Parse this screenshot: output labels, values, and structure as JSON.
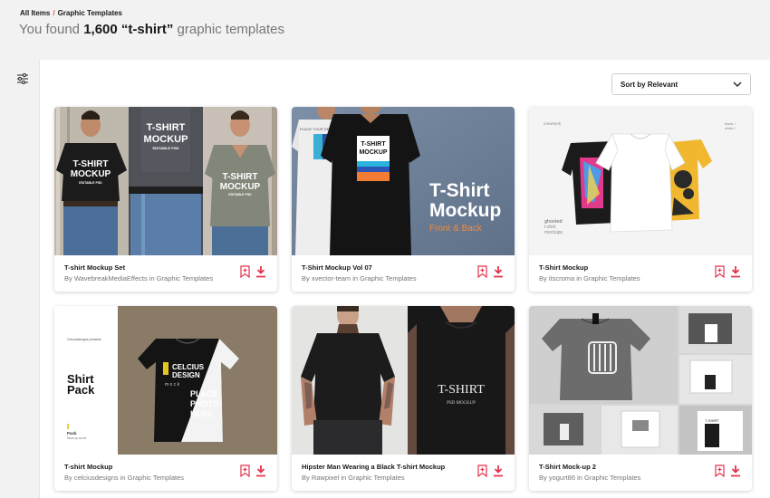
{
  "breadcrumb": {
    "all_items": "All Items",
    "separator": "/",
    "current": "Graphic Templates"
  },
  "headline": {
    "prefix": "You found ",
    "count_query": "1,600 “t-shirt”",
    "suffix": " graphic templates"
  },
  "sort": {
    "selected": "Sort by Relevant"
  },
  "icons": {
    "filter": "filter-sliders-icon",
    "chevron": "chevron-down-icon",
    "bookmark": "bookmark-add-icon",
    "download": "download-icon"
  },
  "colors": {
    "accent": "#e4324b",
    "breadcrumb_separator": "#e35a4f",
    "text_muted": "#767676"
  },
  "items": [
    {
      "title": "T-shirt Mockup Set",
      "author": "By WavebreakMediaEffects in Graphic Templates",
      "thumb": {
        "shirt1_line1": "T-SHIRT",
        "shirt1_line2": "MOCKUP",
        "shirt1_line3": "EDITABLE PSD",
        "shirt2_line1": "T-SHIRT",
        "shirt2_line2": "MOCKUP",
        "shirt2_line3": "EDITABLE PSD",
        "shirt3_line1": "T-SHIRT",
        "shirt3_line2": "MOCKUP",
        "shirt3_line3": "EDITABLE PSD"
      }
    },
    {
      "title": "T-Shirt Mockup Vol 07",
      "author": "By xvector-team in Graphic Templates",
      "thumb": {
        "heading_line1": "T-Shirt",
        "heading_line2": "Mockup",
        "tagline": "Front & Back",
        "shirt_line1": "T-SHIRT",
        "shirt_line2": "MOCKUP",
        "white_shirt": "PLACE YOUR DESIGN"
      }
    },
    {
      "title": "T-Shirt Mockup",
      "author": "By itscroma in Graphic Templates",
      "thumb": {
        "corner_left": "crewneck",
        "corner_right_1": "black /",
        "corner_right_2": "white /",
        "caption_1": "ghosted",
        "caption_2": "t-shirt",
        "caption_3": "mockups"
      }
    },
    {
      "title": "T-shirt Mockup",
      "author": "By celciusdesigns in Graphic Templates",
      "thumb": {
        "studio": "Celciusdesigns presents",
        "heading_line1": "Shirt",
        "heading_line2": "Pack",
        "sub_line1": "Pack",
        "sub_line2": "Mock up scene",
        "shirt_brand_1": "CELCIUS",
        "shirt_brand_2": "DESIGN",
        "shirt_sub": "m o c k",
        "place_1": "PLACE",
        "place_2": "PHOTO",
        "place_3": "HERE"
      }
    },
    {
      "title": "Hipster Man Wearing a Black T-shirt Mockup",
      "author": "By Rawpixel in Graphic Templates",
      "thumb": {
        "shirt_line1": "T-SHIRT",
        "shirt_line2": "PSD MOCKUP"
      }
    },
    {
      "title": "T-Shirt Mock-up 2",
      "author": "By yogurt86 in Graphic Templates",
      "thumb": {
        "tag_brand": "T-SHIRT"
      }
    }
  ]
}
